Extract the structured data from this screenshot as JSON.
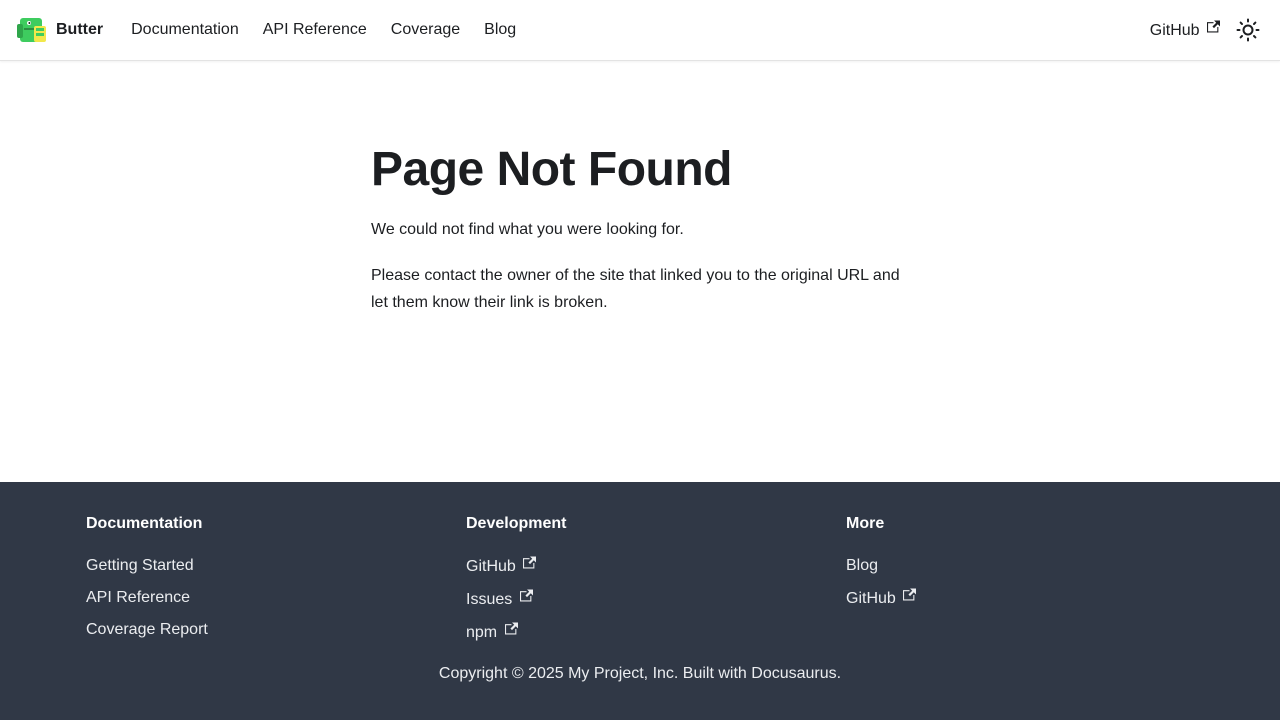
{
  "navbar": {
    "brand_title": "Butter",
    "logo_icon": "dinosaur-logo-icon",
    "links": [
      {
        "label": "Documentation"
      },
      {
        "label": "API Reference"
      },
      {
        "label": "Coverage"
      },
      {
        "label": "Blog"
      }
    ],
    "github_label": "GitHub",
    "theme_toggle_icon": "sun-icon"
  },
  "main": {
    "title": "Page Not Found",
    "paragraph_1": "We could not find what you were looking for.",
    "paragraph_2": "Please contact the owner of the site that linked you to the original URL and let them know their link is broken."
  },
  "footer": {
    "columns": [
      {
        "title": "Documentation",
        "links": [
          {
            "label": "Getting Started",
            "external": false
          },
          {
            "label": "API Reference",
            "external": false
          },
          {
            "label": "Coverage Report",
            "external": false
          }
        ]
      },
      {
        "title": "Development",
        "links": [
          {
            "label": "GitHub",
            "external": true
          },
          {
            "label": "Issues",
            "external": true
          },
          {
            "label": "npm",
            "external": true
          }
        ]
      },
      {
        "title": "More",
        "links": [
          {
            "label": "Blog",
            "external": false
          },
          {
            "label": "GitHub",
            "external": true
          }
        ]
      }
    ],
    "copyright": "Copyright © 2025 My Project, Inc. Built with Docusaurus."
  },
  "colors": {
    "footer_bg": "#303846",
    "logo_green": "#3ecc5f"
  }
}
